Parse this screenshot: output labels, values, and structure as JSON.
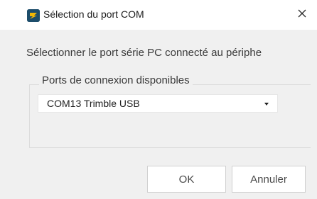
{
  "window": {
    "title": "Sélection du port COM",
    "close_label": "×",
    "icon": "trimble-app-icon"
  },
  "dialog": {
    "prompt": "Sélectionner le port série PC connecté au périphe",
    "group_label": "Ports de connexion disponibles",
    "port_select": {
      "selected": "COM13 Trimble USB"
    }
  },
  "buttons": {
    "ok_label": "OK",
    "cancel_label": "Annuler"
  }
}
